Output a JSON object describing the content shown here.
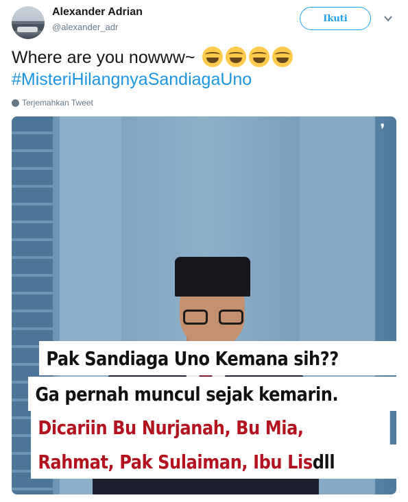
{
  "tweet": {
    "author_name": "Alexander Adrian",
    "author_handle": "@alexander_adr",
    "follow_label": "Ikuti",
    "text_main": "Where are you nowww~",
    "emojis": [
      "face-with-tears-of-joy",
      "face-with-tears-of-joy",
      "face-with-tears-of-joy",
      "face-with-tears-of-joy"
    ],
    "hashtag": "#MisteriHilangnyaSandiagaUno",
    "translate_label": "Terjemahkan Tweet",
    "accent_color": "#1da1f2"
  },
  "image": {
    "caption_line1": "Pak Sandiaga Uno Kemana sih??",
    "caption_line2": "Ga pernah muncul sejak kemarin.",
    "caption_line3": "Dicariin Bu Nurjanah, Bu Mia,",
    "caption_line4_red": "Rahmat, Pak Sulaiman, Ibu Lis",
    "caption_line4_dark": " dll",
    "caption_red_color": "#b3121f"
  }
}
